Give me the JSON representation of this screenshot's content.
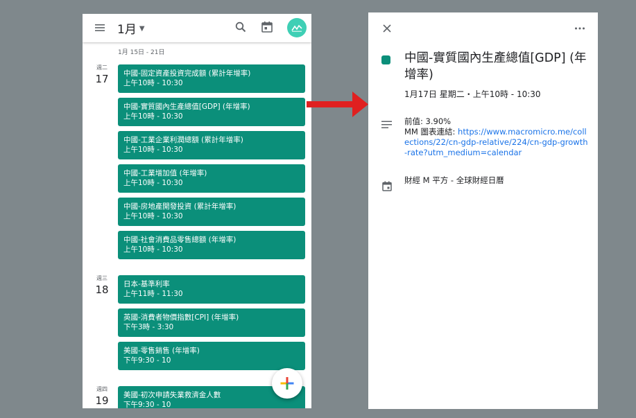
{
  "calendar_view": {
    "month": "1月",
    "week_range": "1月 15日 - 21日",
    "days": [
      {
        "dow": "週二",
        "dom": "17",
        "events": [
          {
            "title": "中國-固定資產投資完成額 (累計年增率)",
            "time": "上午10時 - 10:30"
          },
          {
            "title": "中國-實質國內生產總值[GDP] (年增率)",
            "time": "上午10時 - 10:30"
          },
          {
            "title": "中國-工業企業利潤總額 (累計年增率)",
            "time": "上午10時 - 10:30"
          },
          {
            "title": "中國-工業增加值 (年增率)",
            "time": "上午10時 - 10:30"
          },
          {
            "title": "中國-房地產開發投資 (累計年增率)",
            "time": "上午10時 - 10:30"
          },
          {
            "title": "中國-社會消費品零售總額 (年增率)",
            "time": "上午10時 - 10:30"
          }
        ]
      },
      {
        "dow": "週三",
        "dom": "18",
        "events": [
          {
            "title": "日本-基準利率",
            "time": "上午11時 - 11:30"
          },
          {
            "title": "英國-消費者物價指數[CPI] (年增率)",
            "time": "下午3時 - 3:30"
          },
          {
            "title": "美國-零售銷售 (年增率)",
            "time": "下午9:30 - 10"
          }
        ]
      },
      {
        "dow": "週四",
        "dom": "19",
        "events": [
          {
            "title": "美國-初次申請失業救濟金人數",
            "time": "下午9:30 - 10"
          }
        ]
      }
    ]
  },
  "event_detail": {
    "title": "中國-實質國內生產總值[GDP] (年增率)",
    "when": "1月17日 星期二・上午10時 - 10:30",
    "notes_prev": "前值: 3.90%",
    "notes_link_label": "MM 圖表連結: ",
    "notes_link": "https://www.macromicro.me/collections/22/cn-gdp-relative/224/cn-gdp-growth-rate?utm_medium=calendar",
    "calendar_name": "財經 M 平方 - 全球財經日曆"
  },
  "colors": {
    "event": "#0b8f7a",
    "avatar": "#3fcfb5",
    "link": "#1a73e8",
    "arrow": "#e02020",
    "background": "#7f888c"
  },
  "icons": [
    "menu-icon",
    "caret-down-icon",
    "search-icon",
    "today-icon",
    "avatar-chart-icon",
    "add-icon",
    "close-icon",
    "more-icon",
    "notes-icon",
    "calendar-icon"
  ]
}
